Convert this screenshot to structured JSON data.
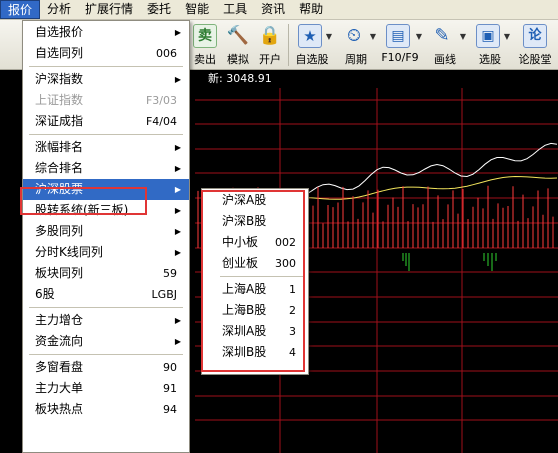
{
  "menubar": {
    "items": [
      "报价",
      "分析",
      "扩展行情",
      "委托",
      "智能",
      "工具",
      "资讯",
      "帮助"
    ]
  },
  "toolbar": {
    "buttons": [
      {
        "label": "卖出",
        "icon_char": "卖",
        "color": "#2e7d32"
      },
      {
        "label": "模拟",
        "icon_char": "🔨",
        "color": "#8d5a2b"
      },
      {
        "label": "开户",
        "icon_char": "🔒",
        "color": "#c9a227"
      },
      {
        "label": "自选股",
        "icon_char": "★",
        "color": "#1f5fb4"
      },
      {
        "label": "周期",
        "icon_char": "⏲",
        "color": "#1f5fb4"
      },
      {
        "label": "F10/F9",
        "icon_char": "▤",
        "color": "#1f5fb4"
      },
      {
        "label": "画线",
        "icon_char": "✎",
        "color": "#1f5fb4"
      },
      {
        "label": "选股",
        "icon_char": "▣",
        "color": "#1f5fb4"
      },
      {
        "label": "论股堂",
        "icon_char": "论",
        "color": "#1f5fb4"
      }
    ]
  },
  "info": {
    "text": "新: 3048.91"
  },
  "menu": {
    "items": [
      {
        "label": "自选报价",
        "shortcut": "",
        "arrow": true,
        "disabled": false,
        "highlighted": false
      },
      {
        "label": "自选同列",
        "shortcut": "006",
        "arrow": false,
        "disabled": false,
        "highlighted": false
      },
      {
        "sep": true
      },
      {
        "label": "沪深指数",
        "shortcut": "",
        "arrow": true,
        "disabled": false,
        "highlighted": false
      },
      {
        "label": "上证指数",
        "shortcut": "F3/03",
        "arrow": false,
        "disabled": true,
        "highlighted": false
      },
      {
        "label": "深证成指",
        "shortcut": "F4/04",
        "arrow": false,
        "disabled": false,
        "highlighted": false
      },
      {
        "sep": true
      },
      {
        "label": "涨幅排名",
        "shortcut": "",
        "arrow": true,
        "disabled": false,
        "highlighted": false
      },
      {
        "label": "综合排名",
        "shortcut": "",
        "arrow": true,
        "disabled": false,
        "highlighted": false
      },
      {
        "label": "沪深股票",
        "shortcut": "",
        "arrow": true,
        "disabled": false,
        "highlighted": true
      },
      {
        "label": "股转系统(新三板)",
        "shortcut": "",
        "arrow": true,
        "disabled": false,
        "highlighted": false
      },
      {
        "label": "多股同列",
        "shortcut": "",
        "arrow": true,
        "disabled": false,
        "highlighted": false
      },
      {
        "label": "分时K线同列",
        "shortcut": "",
        "arrow": true,
        "disabled": false,
        "highlighted": false
      },
      {
        "label": "板块同列",
        "shortcut": "59",
        "arrow": false,
        "disabled": false,
        "highlighted": false
      },
      {
        "label": "6股",
        "shortcut": "LGBJ",
        "arrow": false,
        "disabled": false,
        "highlighted": false
      },
      {
        "sep": true
      },
      {
        "label": "主力增仓",
        "shortcut": "",
        "arrow": true,
        "disabled": false,
        "highlighted": false
      },
      {
        "label": "资金流向",
        "shortcut": "",
        "arrow": true,
        "disabled": false,
        "highlighted": false
      },
      {
        "sep": true
      },
      {
        "label": "多窗看盘",
        "shortcut": "90",
        "arrow": false,
        "disabled": false,
        "highlighted": false
      },
      {
        "label": "主力大单",
        "shortcut": "91",
        "arrow": false,
        "disabled": false,
        "highlighted": false
      },
      {
        "label": "板块热点",
        "shortcut": "94",
        "arrow": false,
        "disabled": false,
        "highlighted": false
      }
    ]
  },
  "submenu": {
    "items": [
      {
        "label": "沪深A股",
        "shortcut": ""
      },
      {
        "label": "沪深B股",
        "shortcut": ""
      },
      {
        "label": "中小板",
        "shortcut": "002"
      },
      {
        "label": "创业板",
        "shortcut": "300"
      },
      {
        "sep": true
      },
      {
        "label": "上海A股",
        "shortcut": "1"
      },
      {
        "label": "上海B股",
        "shortcut": "2"
      },
      {
        "label": "深圳A股",
        "shortcut": "3"
      },
      {
        "label": "深圳B股",
        "shortcut": "4"
      }
    ]
  },
  "colors": {
    "highlight": "#316ac5",
    "annotation": "#e03535",
    "grid": "#a0101a",
    "price_line": "#ffffff",
    "avg_line": "#f2e45c",
    "vol_up": "#ff3b3b",
    "vol_down": "#2fd42f"
  }
}
